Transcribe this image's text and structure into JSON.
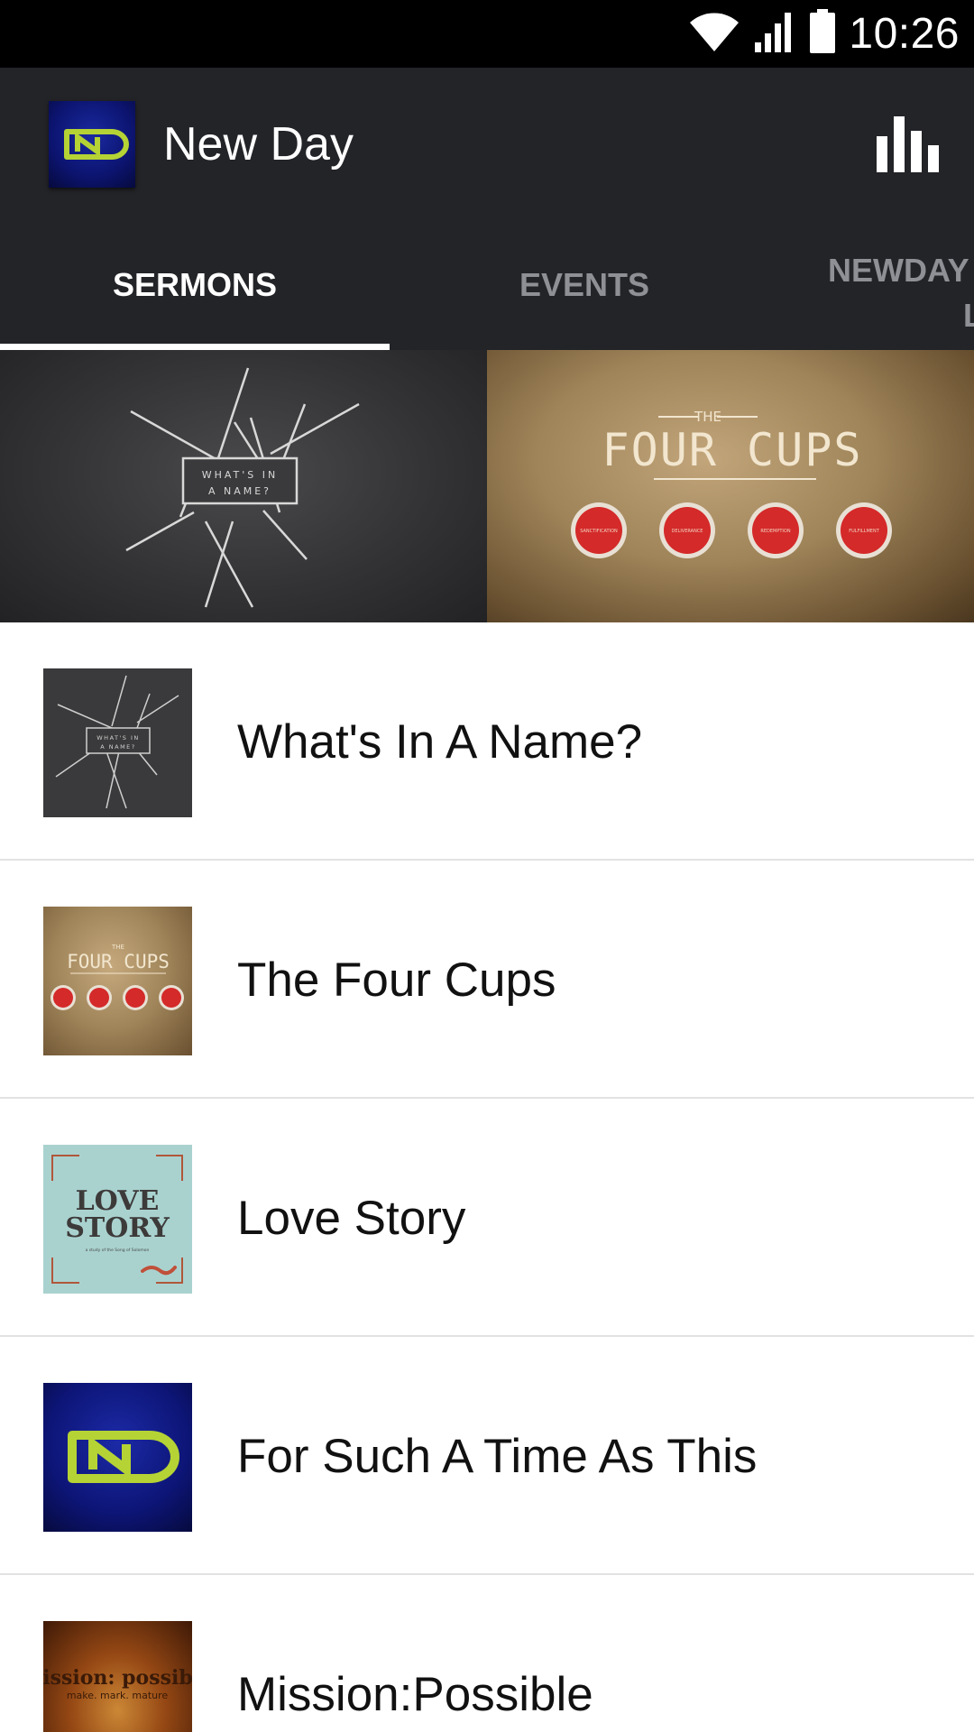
{
  "status_bar": {
    "time": "10:26",
    "icons": [
      "wifi-icon",
      "cell-signal-icon",
      "battery-icon"
    ]
  },
  "app_bar": {
    "title": "New Day",
    "logo_text": "ND",
    "action_icon": "bar-chart-icon"
  },
  "tabs": [
    {
      "label": "SERMONS",
      "selected": true
    },
    {
      "label": "EVENTS",
      "selected": false
    },
    {
      "label": "NEWDAY",
      "label_line2": "L",
      "selected": false
    }
  ],
  "banner": {
    "left": {
      "line1": "WHAT'S IN",
      "line2": "A NAME?"
    },
    "right": {
      "kicker": "THE",
      "title": "FOUR CUPS",
      "cup_labels": [
        "SANCTIFICATION",
        "DELIVERANCE",
        "REDEMPTION",
        "FULFILLMENT"
      ]
    }
  },
  "sermons": [
    {
      "title": "What's In A Name?",
      "thumb_text": [
        "WHAT'S IN",
        "A NAME?"
      ]
    },
    {
      "title": "The Four Cups",
      "thumb_text": [
        "THE",
        "FOUR CUPS"
      ]
    },
    {
      "title": "Love Story",
      "thumb_text": [
        "LOVE",
        "STORY",
        "a study of the Song of Solomon"
      ]
    },
    {
      "title": "For Such A Time As This",
      "thumb_text": [
        "ND"
      ]
    },
    {
      "title": "Mission:Possible",
      "thumb_text": [
        "mission: possible",
        "make. mark. mature"
      ]
    }
  ],
  "colors": {
    "status_bar": "#000000",
    "app_bar": "#232428",
    "tab_active": "#ffffff",
    "tab_inactive": "#8f9095",
    "logo_green": "#b5d334",
    "logo_blue": "#0d1577",
    "cup_red": "#d42a2a"
  }
}
